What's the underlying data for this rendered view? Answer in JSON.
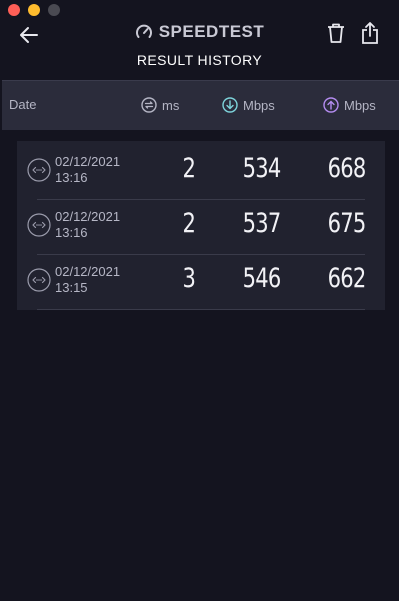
{
  "app": {
    "brand": "SPEEDTEST",
    "title": "RESULT HISTORY"
  },
  "colors": {
    "background": "#14141f",
    "header_bar": "#2b2c3b",
    "results_panel": "#21222f",
    "download_accent": "#7ed4db",
    "upload_accent": "#b48cf0"
  },
  "icons": {
    "back": "arrow-left-icon",
    "brand": "speedometer-icon",
    "trash": "trash-icon",
    "share": "share-icon",
    "ping": "ping-icon",
    "download": "download-icon",
    "upload": "upload-icon",
    "row": "connection-icon"
  },
  "columns": {
    "date": "Date",
    "ping": "ms",
    "download": "Mbps",
    "upload": "Mbps"
  },
  "results": [
    {
      "date": "02/12/2021",
      "time": "13:16",
      "ping": "2",
      "download": "534",
      "upload": "668"
    },
    {
      "date": "02/12/2021",
      "time": "13:16",
      "ping": "2",
      "download": "537",
      "upload": "675"
    },
    {
      "date": "02/12/2021",
      "time": "13:15",
      "ping": "3",
      "download": "546",
      "upload": "662"
    }
  ]
}
